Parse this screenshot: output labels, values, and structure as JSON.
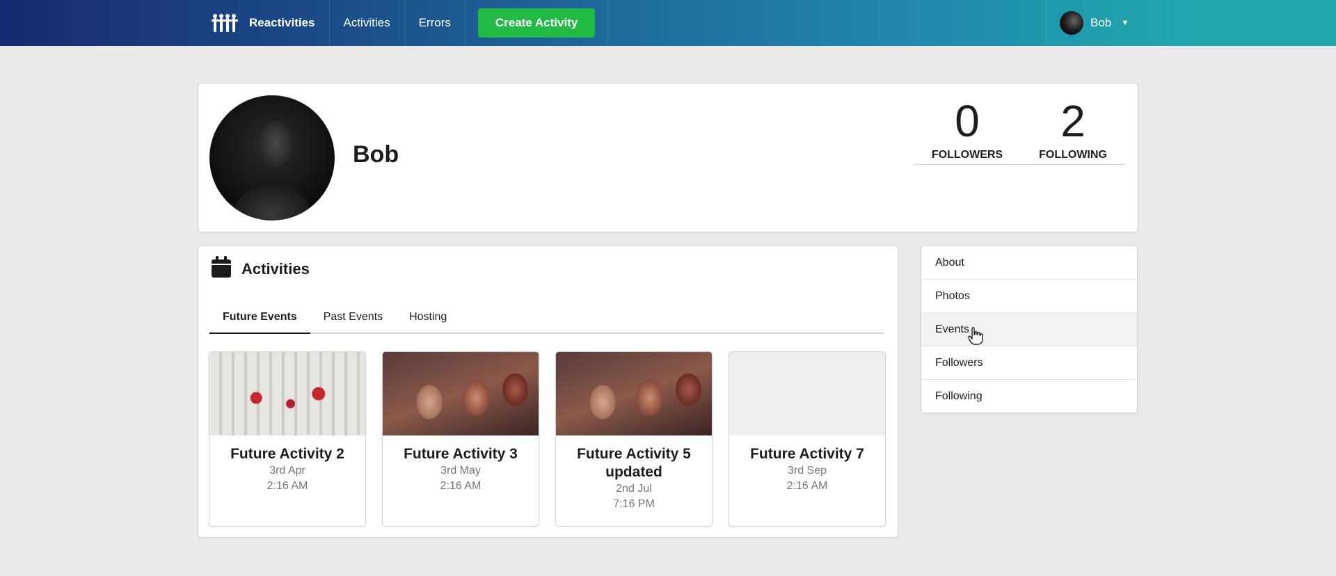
{
  "navbar": {
    "brand": "Reactivities",
    "activities": "Activities",
    "errors": "Errors",
    "create": "Create Activity",
    "user": "Bob"
  },
  "profile": {
    "name": "Bob",
    "followers_count": "0",
    "followers_label": "FOLLOWERS",
    "following_count": "2",
    "following_label": "FOLLOWING"
  },
  "activities": {
    "title": "Activities",
    "tabs": [
      "Future Events",
      "Past Events",
      "Hosting"
    ],
    "events": [
      {
        "title": "Future Activity 2",
        "date": "3rd Apr",
        "time": "2:16 AM"
      },
      {
        "title": "Future Activity 3",
        "date": "3rd May",
        "time": "2:16 AM"
      },
      {
        "title": "Future Activity 5 updated",
        "date": "2nd Jul",
        "time": "7:16 PM"
      },
      {
        "title": "Future Activity 7",
        "date": "3rd Sep",
        "time": "2:16 AM"
      }
    ]
  },
  "menu": [
    "About",
    "Photos",
    "Events",
    "Followers",
    "Following"
  ],
  "colors": {
    "accent_green": "#21ba45",
    "nav_start": "#182a73",
    "nav_end": "#20a7ac"
  }
}
